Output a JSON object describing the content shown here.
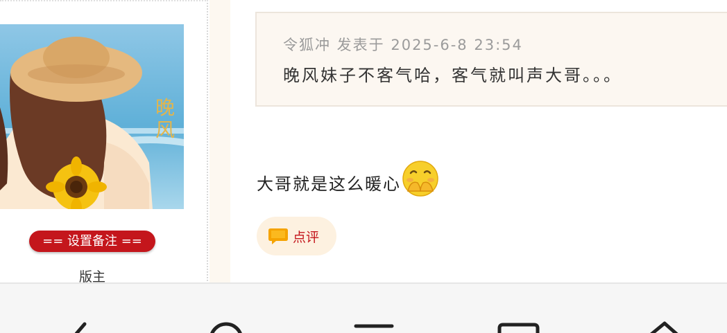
{
  "author": {
    "note_button": "== 设置备注 ==",
    "role": "版主",
    "avatar_icon": "avatar-girl-sunflower",
    "avatar_watermark": "晚风"
  },
  "post": {
    "quote": {
      "meta": "令狐冲 发表于 2025-6-8 23:54",
      "text": "晚风妹子不客气哈，客气就叫声大哥。。。"
    },
    "reply_text": "大哥就是这么暖心",
    "emoji_icon": "shy-face-emoji",
    "comment_button": "点评",
    "comment_icon": "speech-bubble-icon"
  },
  "navbar": {
    "icons": [
      "back-icon",
      "search-icon",
      "menu-icon",
      "tabs-icon",
      "home-icon"
    ]
  },
  "colors": {
    "accent_red": "#c4161c",
    "quote_bg": "#fcf7f1",
    "comment_bg": "#fdf1e0"
  }
}
